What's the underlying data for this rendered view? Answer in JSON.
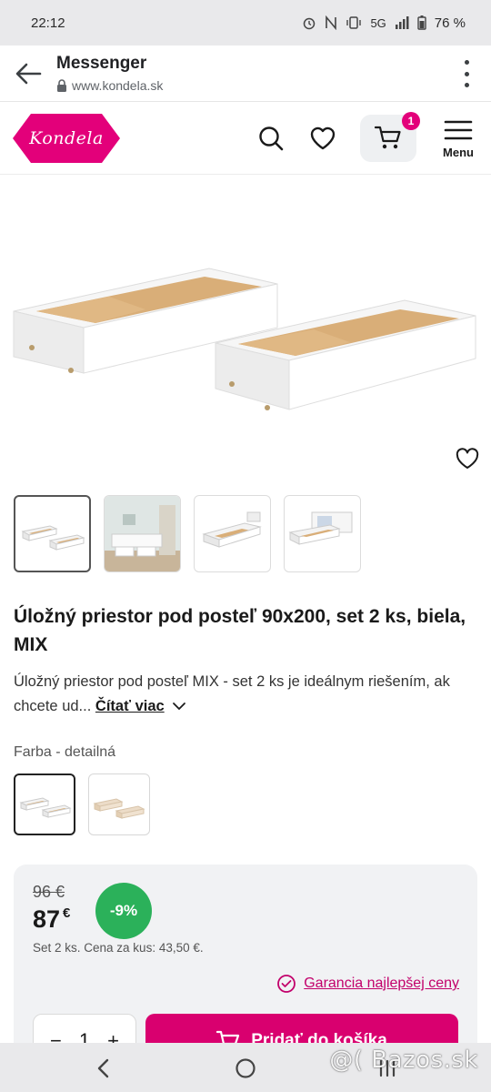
{
  "status": {
    "time": "22:12",
    "network": "5G",
    "battery": "76 %"
  },
  "browser": {
    "title": "Messenger",
    "url": "www.kondela.sk"
  },
  "site": {
    "logo_text": "Kondela",
    "cart_count": "1",
    "menu_label": "Menu"
  },
  "product": {
    "title": "Úložný priestor pod posteľ 90x200, set 2 ks, biela, MIX",
    "description": "Úložný priestor pod posteľ MIX - set 2 ks je ideálnym riešením, ak chcete ud...",
    "read_more": "Čítať viac",
    "color_label": "Farba - detailná"
  },
  "pricing": {
    "old_price": "96 €",
    "new_price": "87",
    "currency": "€",
    "discount": "-9%",
    "unit_price": "Set 2 ks. Cena za kus: 43,50 €.",
    "guarantee": "Garancia najlepšej ceny",
    "quantity": "1",
    "add_to_cart": "Pridať do košíka"
  },
  "watermark": "@( Bazos.sk",
  "colors": {
    "brand": "#e3007a",
    "discount": "#2bb15a",
    "guarantee": "#c2006b"
  }
}
